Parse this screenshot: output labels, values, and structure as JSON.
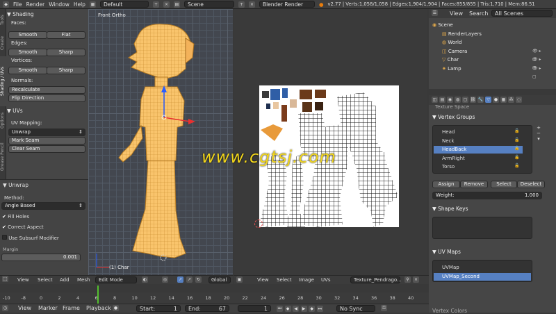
{
  "top_bar": {
    "menus": [
      "File",
      "Render",
      "Window",
      "Help"
    ],
    "layout": "Default",
    "scene": "Scene",
    "engine": "Blender Render",
    "stats": "v2.77 | Verts:1,058/1,058 | Edges:1,904/1,904 | Faces:855/855 | Tris:1,710 | Mem:86.51"
  },
  "tool_tabs": [
    "Tools",
    "Create",
    "Shading / UVs",
    "Options",
    "Grease Pencil"
  ],
  "tool_panel": {
    "shading_title": "Shading",
    "faces_label": "Faces:",
    "smooth": "Smooth",
    "flat": "Flat",
    "edges_label": "Edges:",
    "sharp": "Sharp",
    "vertices_label": "Vertices:",
    "normals_label": "Normals:",
    "recalculate": "Recalculate",
    "flip_direction": "Flip Direction",
    "uvs_title": "UVs",
    "uv_mapping_label": "UV Mapping:",
    "unwrap": "Unwrap",
    "mark_seam": "Mark Seam",
    "clear_seam": "Clear Seam",
    "unwrap_title": "Unwrap",
    "method_label": "Method:",
    "method_value": "Angle Based",
    "fill_holes": "Fill Holes",
    "correct_aspect": "Correct Aspect",
    "use_subsurf": "Use Subsurf Modifier",
    "margin_label": "Margin",
    "margin_value": "0.001"
  },
  "viewport": {
    "view_name": "Front Ortho",
    "object_label": "(1) Char"
  },
  "viewport_header": {
    "view": "View",
    "select": "Select",
    "add": "Add",
    "mesh": "Mesh",
    "mode": "Edit Mode",
    "orientation": "Global"
  },
  "uv_header": {
    "view": "View",
    "select": "Select",
    "image": "Image",
    "uvs": "UVs",
    "image_name": "Texture_Pendrago..."
  },
  "watermark": "www.cgtsj.com",
  "outliner": {
    "view": "View",
    "search": "Search",
    "filter": "All Scenes",
    "items": [
      {
        "label": "Scene",
        "indent": 0
      },
      {
        "label": "RenderLayers",
        "indent": 1
      },
      {
        "label": "World",
        "indent": 1
      },
      {
        "label": "Camera",
        "indent": 1
      },
      {
        "label": "Char",
        "indent": 1
      },
      {
        "label": "Lamp",
        "indent": 1
      }
    ]
  },
  "properties": {
    "texture_space": "Texture Space",
    "vertex_groups_title": "Vertex Groups",
    "vertex_groups": [
      "Head",
      "Neck",
      "HeadBack",
      "ArmRight",
      "Torso"
    ],
    "selected_group": "HeadBack",
    "assign": "Assign",
    "remove": "Remove",
    "select": "Select",
    "deselect": "Deselect",
    "weight_label": "Weight:",
    "weight_value": "1.000",
    "shape_keys_title": "Shape Keys",
    "uv_maps_title": "UV Maps",
    "uv_maps": [
      "UVMap",
      "UVMap_Second"
    ],
    "selected_uv_map": "UVMap_Second",
    "vertex_colors_title": "Vertex Colors"
  },
  "timeline": {
    "ticks": [
      "-10",
      "-8",
      "0",
      "2",
      "4",
      "6",
      "8",
      "10",
      "12",
      "14",
      "16",
      "18",
      "20",
      "22",
      "24",
      "26",
      "28",
      "30",
      "32",
      "34",
      "36",
      "38",
      "40"
    ],
    "view": "View",
    "marker": "Marker",
    "frame": "Frame",
    "playback": "Playback",
    "start_label": "Start:",
    "start_value": "1",
    "end_label": "End:",
    "end_value": "67",
    "current_frame": "1",
    "sync": "No Sync"
  },
  "colors": {
    "selection": "#5680c2",
    "mesh": "#f7c06a",
    "accent_orange": "#e87d0d"
  }
}
